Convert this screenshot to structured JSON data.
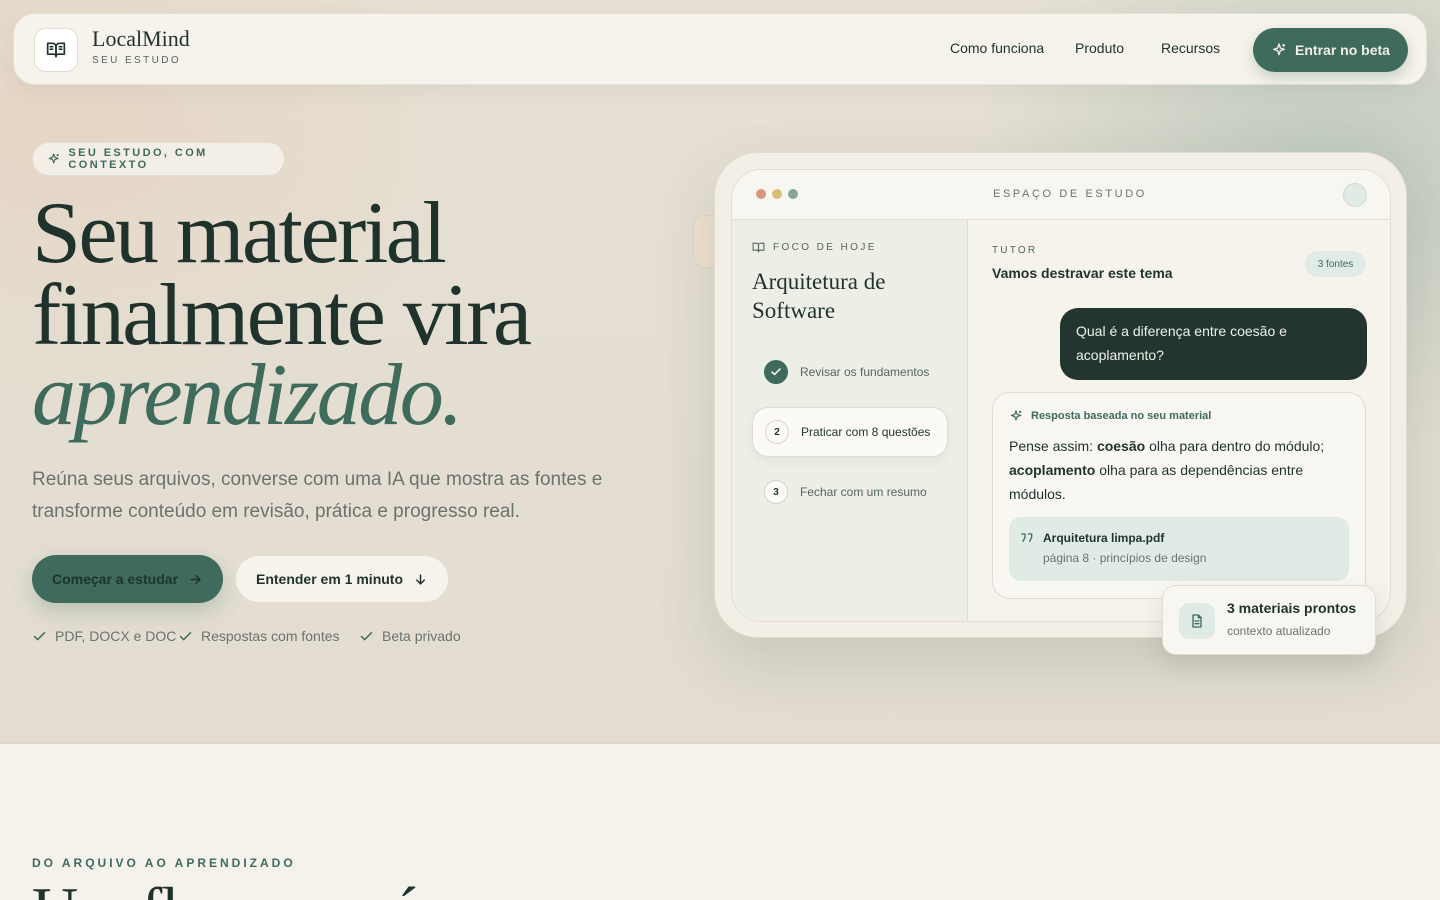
{
  "brand": {
    "name": "LocalMind",
    "tagline": "SEU ESTUDO"
  },
  "nav": {
    "links": [
      "Como funciona",
      "Produto",
      "Recursos"
    ],
    "cta": "Entrar no beta"
  },
  "hero": {
    "badge": "SEU ESTUDO, COM CONTEXTO",
    "headline_line1": "Seu material",
    "headline_line2": "finalmente vira",
    "headline_line3": "aprendizado.",
    "lead": "Reúna seus arquivos, converse com uma IA que mostra as fontes e transforme conteúdo em revisão, prática e progresso real.",
    "primary_cta": "Começar a estudar",
    "secondary_cta": "Entender em 1 minuto",
    "checks": [
      "PDF, DOCX e DOC",
      "Respostas com fontes",
      "Beta privado"
    ]
  },
  "mockup": {
    "window_title": "ESPAÇO DE ESTUDO",
    "sidebar": {
      "kicker": "FOCO DE HOJE",
      "title": "Arquitetura de Software",
      "steps": [
        {
          "num": "1",
          "label": "Revisar os fundamentos",
          "state": "done"
        },
        {
          "num": "2",
          "label": "Praticar com 8 questões",
          "state": "active"
        },
        {
          "num": "3",
          "label": "Fechar com um resumo",
          "state": "pending"
        }
      ]
    },
    "chat": {
      "kicker": "TUTOR",
      "title": "Vamos destravar este tema",
      "sources_badge": "3 fontes",
      "user_message": "Qual é a diferença entre coesão e acoplamento?",
      "answer_label": "Resposta baseada no seu material",
      "answer_prefix": "Pense assim: ",
      "answer_term1": "coesão",
      "answer_mid": " olha para dentro do módulo; ",
      "answer_term2": "acoplamento",
      "answer_suffix": " olha para as dependências entre módulos.",
      "citation_file": "Arquitetura limpa.pdf",
      "citation_page": "página 8 · princípios de design"
    },
    "float_card": {
      "title": "3 materiais prontos",
      "subtitle": "contexto atualizado"
    }
  },
  "next_section": {
    "kicker": "DO ARQUIVO AO APRENDIZADO",
    "title_partial": "Um fluxo que é"
  },
  "colors": {
    "accent": "#3f6b5c",
    "ink": "#1f322c",
    "dark_bubble": "#22362f",
    "dot_red": "#d7957e",
    "dot_yellow": "#d8bf78",
    "dot_green": "#86a596"
  },
  "icons": [
    "book-open-icon",
    "sparkle-icon",
    "arrow-right-icon",
    "arrow-down-icon",
    "check-icon",
    "quote-icon",
    "file-text-icon"
  ]
}
